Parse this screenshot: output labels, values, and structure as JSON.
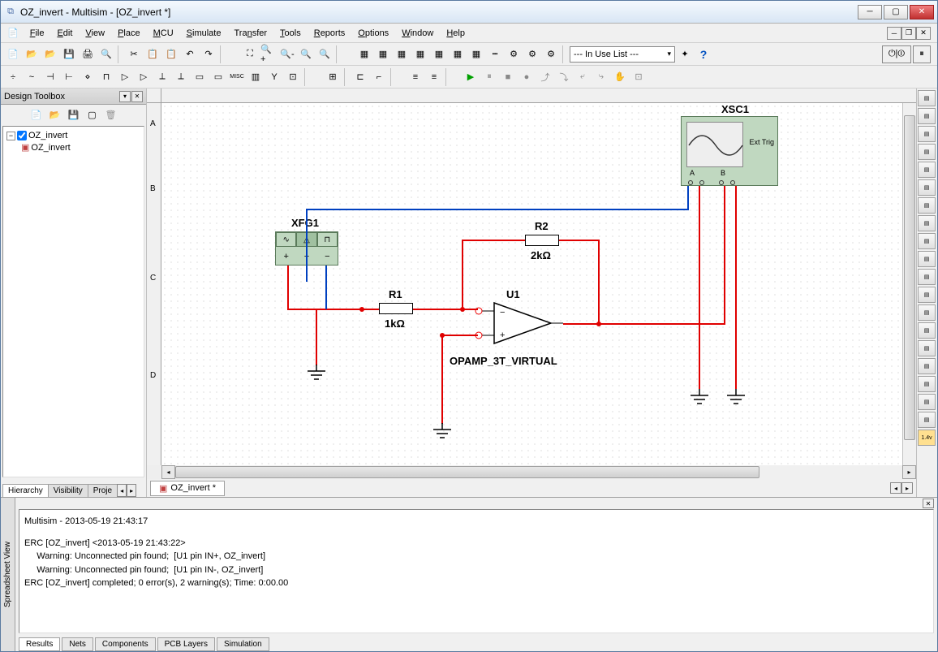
{
  "title": "OZ_invert - Multisim - [OZ_invert *]",
  "menu": [
    "File",
    "Edit",
    "View",
    "Place",
    "MCU",
    "Simulate",
    "Transfer",
    "Tools",
    "Reports",
    "Options",
    "Window",
    "Help"
  ],
  "combo_label": "--- In Use List ---",
  "design_toolbox": {
    "title": "Design Toolbox",
    "root": "OZ_invert",
    "child": "OZ_invert",
    "tabs": [
      "Hierarchy",
      "Visibility",
      "Proje"
    ]
  },
  "ruler_v": [
    "A",
    "B",
    "C",
    "D"
  ],
  "doc_tab": "OZ_invert *",
  "components": {
    "xfg1": "XFG1",
    "xsc1": "XSC1",
    "r1_name": "R1",
    "r1_val": "1kΩ",
    "r2_name": "R2",
    "r2_val": "2kΩ",
    "u1": "U1",
    "opamp": "OPAMP_3T_VIRTUAL",
    "scope_ext": "Ext Trig",
    "scope_a": "A",
    "scope_b": "B"
  },
  "spreadsheet": {
    "label": "Spreadsheet View",
    "header": "Multisim  -  2013-05-19 21:43:17",
    "lines": [
      "ERC [OZ_invert]  <2013-05-19 21:43:22>",
      "     Warning: Unconnected pin found;  [U1 pin IN+, OZ_invert]",
      "     Warning: Unconnected pin found;  [U1 pin IN-, OZ_invert]",
      "ERC [OZ_invert] completed;  0 error(s), 2 warning(s);  Time: 0:00.00"
    ],
    "tabs": [
      "Results",
      "Nets",
      "Components",
      "PCB Layers",
      "Simulation"
    ]
  }
}
